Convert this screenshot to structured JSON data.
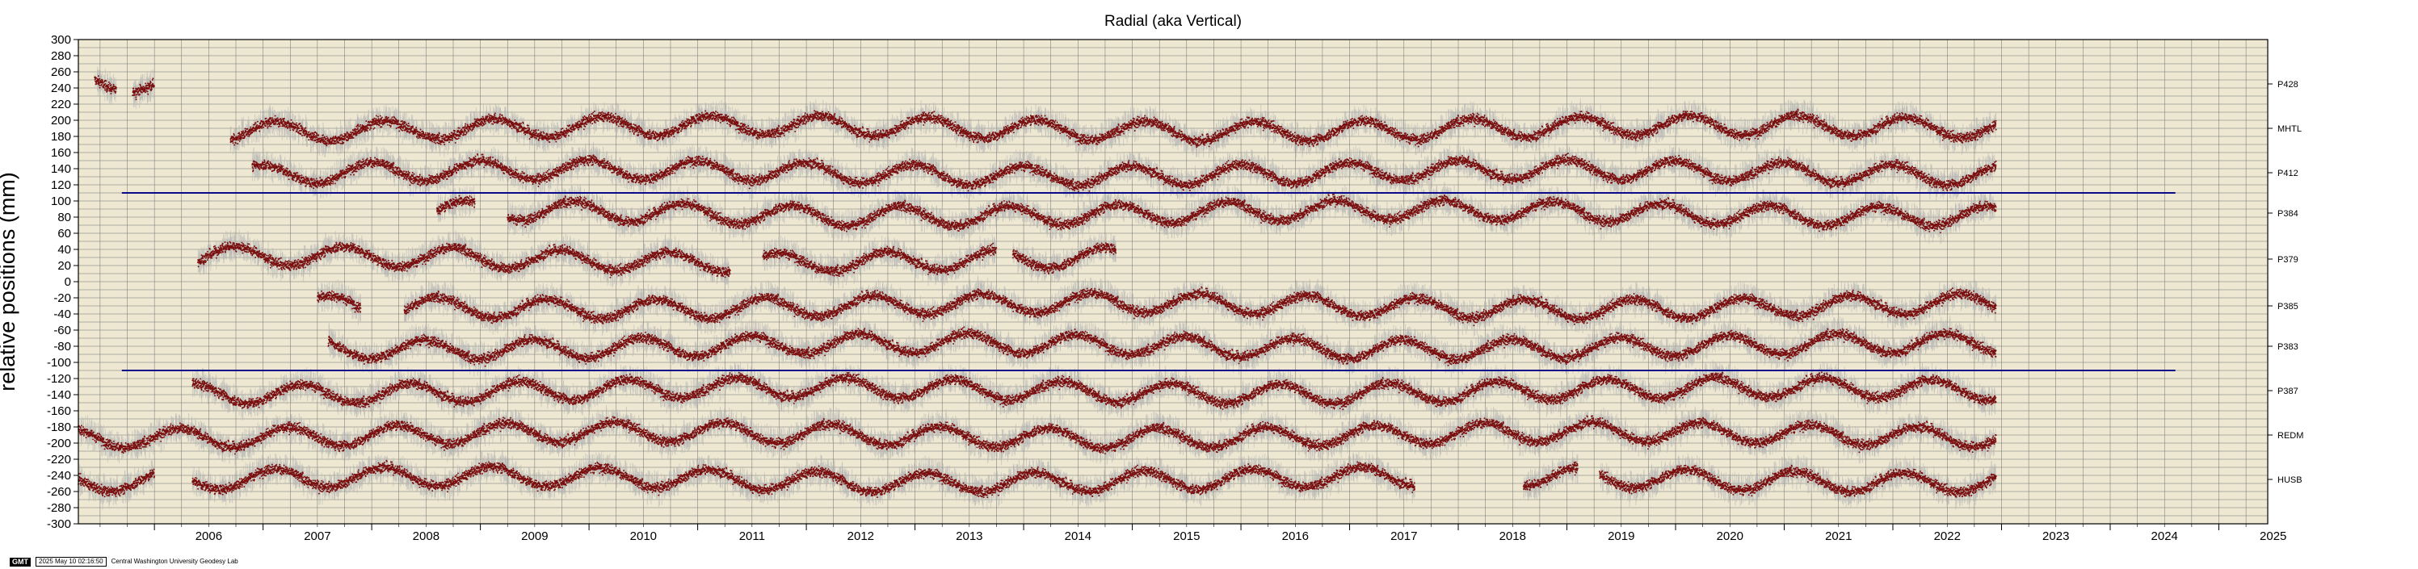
{
  "chart_data": {
    "type": "scatter",
    "title": "Radial (aka Vertical)",
    "ylabel": "relative positions (mm)",
    "xlabel": "",
    "xlim": [
      2005.3,
      2025.45
    ],
    "ylim": [
      -300,
      300
    ],
    "x_ticks": [
      "2006",
      "2007",
      "2008",
      "2009",
      "2010",
      "2011",
      "2012",
      "2013",
      "2014",
      "2015",
      "2016",
      "2017",
      "2018",
      "2019",
      "2020",
      "2021",
      "2022",
      "2023",
      "2024",
      "2025"
    ],
    "y_ticks": [
      300,
      280,
      260,
      240,
      220,
      200,
      180,
      160,
      140,
      120,
      100,
      80,
      60,
      40,
      20,
      0,
      -20,
      -40,
      -60,
      -80,
      -100,
      -120,
      -140,
      -160,
      -180,
      -200,
      -220,
      -240,
      -260,
      -280,
      -300
    ],
    "grid": true,
    "reference_lines": [
      {
        "y": 110,
        "x_start": 2005.7,
        "x_end": 2024.6
      },
      {
        "y": -110,
        "x_start": 2005.7,
        "x_end": 2024.6
      }
    ],
    "series": [
      {
        "name": "P428",
        "offset": 245,
        "segments": [
          [
            2005.45,
            2005.65
          ],
          [
            2005.8,
            2006.0
          ]
        ]
      },
      {
        "name": "MHTL",
        "offset": 190,
        "segments": [
          [
            2006.7,
            2022.95
          ]
        ]
      },
      {
        "name": "P412",
        "offset": 135,
        "segments": [
          [
            2006.9,
            2022.95
          ]
        ]
      },
      {
        "name": "P384",
        "offset": 85,
        "segments": [
          [
            2008.6,
            2008.95
          ],
          [
            2009.25,
            2022.95
          ]
        ]
      },
      {
        "name": "P379",
        "offset": 28,
        "segments": [
          [
            2006.4,
            2011.3
          ],
          [
            2011.6,
            2013.75
          ],
          [
            2013.9,
            2014.85
          ]
        ]
      },
      {
        "name": "P385",
        "offset": -30,
        "segments": [
          [
            2007.5,
            2007.9
          ],
          [
            2008.3,
            2022.95
          ]
        ]
      },
      {
        "name": "P383",
        "offset": -80,
        "segments": [
          [
            2007.6,
            2022.95
          ]
        ]
      },
      {
        "name": "P387",
        "offset": -135,
        "segments": [
          [
            2006.35,
            2022.95
          ]
        ]
      },
      {
        "name": "REDM",
        "offset": -190,
        "segments": [
          [
            2005.3,
            2022.95
          ]
        ]
      },
      {
        "name": "HUSB",
        "offset": -245,
        "segments": [
          [
            2005.3,
            2006.0
          ],
          [
            2006.35,
            2017.6
          ],
          [
            2018.6,
            2019.1
          ],
          [
            2019.3,
            2022.95
          ]
        ]
      }
    ],
    "colors": {
      "plot_background": "#eee8d2",
      "grid": "#6e6e6e",
      "points": "#7a0e0e",
      "uncertainty": "#b4b4b4",
      "reference_line": "#0a0a8a"
    }
  },
  "footer": {
    "logo": "GMT",
    "timestamp": "2025 May 10 02:16:50",
    "credit": "Central Washington University Geodesy Lab"
  }
}
